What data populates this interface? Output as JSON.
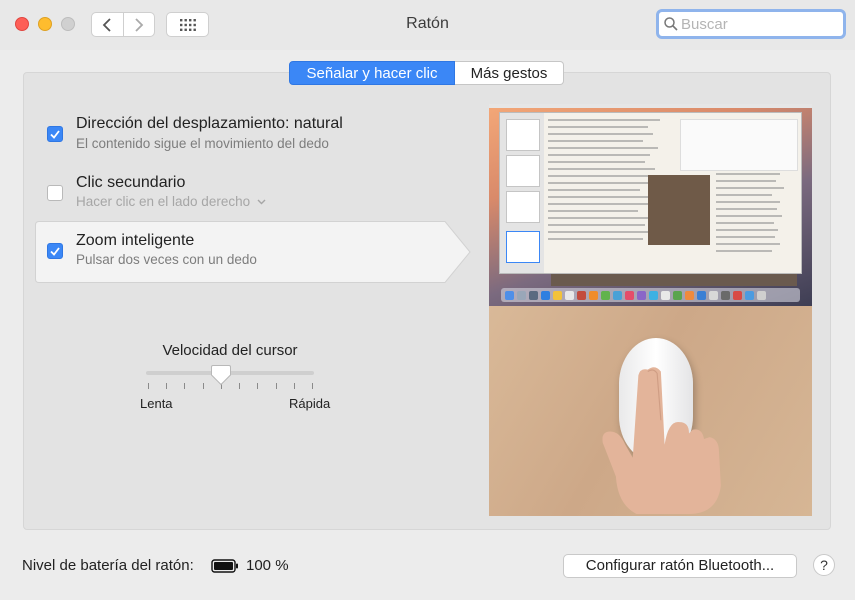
{
  "window": {
    "title": "Ratón"
  },
  "search": {
    "placeholder": "Buscar"
  },
  "tabs": [
    {
      "label": "Señalar y hacer clic",
      "active": true
    },
    {
      "label": "Más gestos",
      "active": false
    }
  ],
  "options": [
    {
      "title": "Dirección del desplazamiento: natural",
      "subtitle": "El contenido sigue el movimiento del dedo",
      "checked": true
    },
    {
      "title": "Clic secundario",
      "subtitle": "Hacer clic en el lado derecho",
      "checked": false
    },
    {
      "title": "Zoom inteligente",
      "subtitle": "Pulsar dos veces con un dedo",
      "checked": true
    }
  ],
  "speed": {
    "label": "Velocidad del cursor",
    "min_label": "Lenta",
    "max_label": "Rápida",
    "ticks": 10,
    "position_tick": 4
  },
  "battery": {
    "label": "Nivel de batería del ratón:",
    "value": "100 %"
  },
  "buttons": {
    "bluetooth": "Configurar ratón Bluetooth...",
    "help": "?"
  },
  "colors": {
    "accent": "#3b87f6",
    "close": "#fe5f57",
    "minimize": "#febc2e"
  }
}
